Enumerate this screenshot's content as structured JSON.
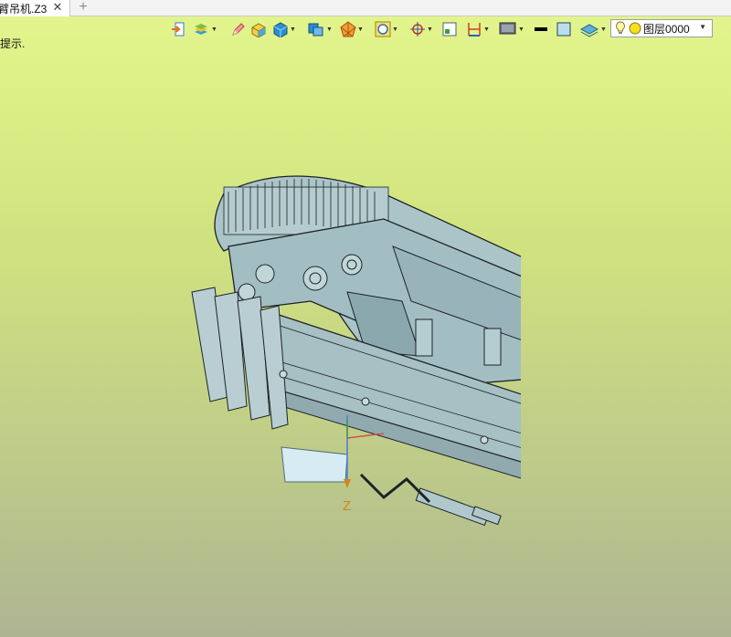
{
  "tab": {
    "title": "臂吊机.Z3",
    "close_symbol": "✕",
    "add_symbol": "+"
  },
  "hint": {
    "text": "提示."
  },
  "toolbar": {
    "icons": [
      "exit-icon",
      "layer-stack-icon",
      "pencil-icon",
      "box-yellow-icon",
      "cube-blue-icon",
      "view-cube-icon",
      "render-sphere-icon",
      "zoom-icon",
      "snap-target-icon",
      "frame-icon",
      "dimension-icon",
      "display-icon",
      "line-color-icon",
      "fill-color-icon",
      "layer-mode-icon"
    ]
  },
  "layer": {
    "label": "图层0000",
    "bulb_color": "#f5e33a",
    "dot_color": "#f5e020"
  },
  "axis": {
    "label": "Z",
    "color": "#d4841a"
  },
  "colors": {
    "model": "#a9c2c6",
    "edge": "#1c2326",
    "bg_top": "#e4f58e",
    "bg_bottom": "#aeb492"
  }
}
